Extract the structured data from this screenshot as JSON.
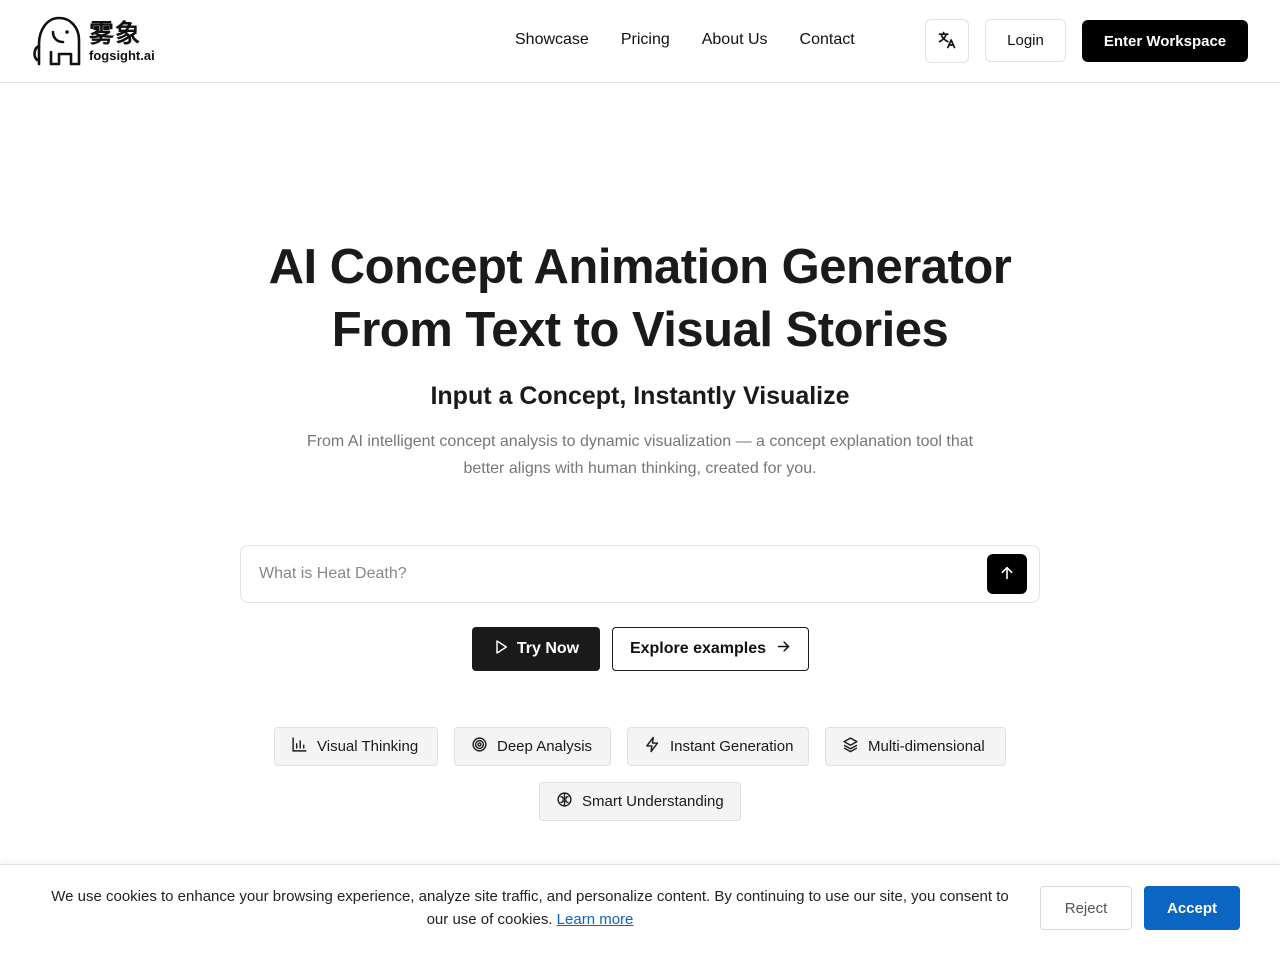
{
  "brand": {
    "name_cn": "雾象",
    "name_en": "fogsight.ai",
    "logo_icon": "elephant-icon"
  },
  "nav": {
    "items": [
      {
        "label": "Showcase"
      },
      {
        "label": "Pricing"
      },
      {
        "label": "About Us"
      },
      {
        "label": "Contact"
      }
    ],
    "language_icon": "translate-icon",
    "login_label": "Login",
    "workspace_label": "Enter Workspace"
  },
  "hero": {
    "title_line1": "AI Concept Animation Generator",
    "title_line2": "From Text to Visual Stories",
    "subtitle": "Input a Concept, Instantly Visualize",
    "description": "From AI intelligent concept analysis to dynamic visualization — a concept explanation tool that better aligns with human thinking, created for you."
  },
  "search": {
    "placeholder": "What is Heat Death?",
    "value": "",
    "submit_icon": "arrow-up-icon"
  },
  "cta": {
    "try_label": "Try Now",
    "try_icon": "play-icon",
    "explore_label": "Explore examples",
    "explore_icon": "arrow-right-icon"
  },
  "features": [
    {
      "label": "Visual Thinking",
      "icon": "bar-chart-icon"
    },
    {
      "label": "Deep Analysis",
      "icon": "target-icon"
    },
    {
      "label": "Instant Generation",
      "icon": "lightning-icon"
    },
    {
      "label": "Multi-dimensional",
      "icon": "layers-icon"
    },
    {
      "label": "Smart Understanding",
      "icon": "brain-icon"
    }
  ],
  "cookie": {
    "text": "We use cookies to enhance your browsing experience, analyze site traffic, and personalize content. By continuing to use our site, you consent to our use of cookies.",
    "learn_more": "Learn more",
    "reject_label": "Reject",
    "accept_label": "Accept"
  },
  "colors": {
    "primary_dark": "#000000",
    "accent_blue": "#0a66c2",
    "chip_bg": "#f4f4f5",
    "muted_text": "#777777"
  }
}
